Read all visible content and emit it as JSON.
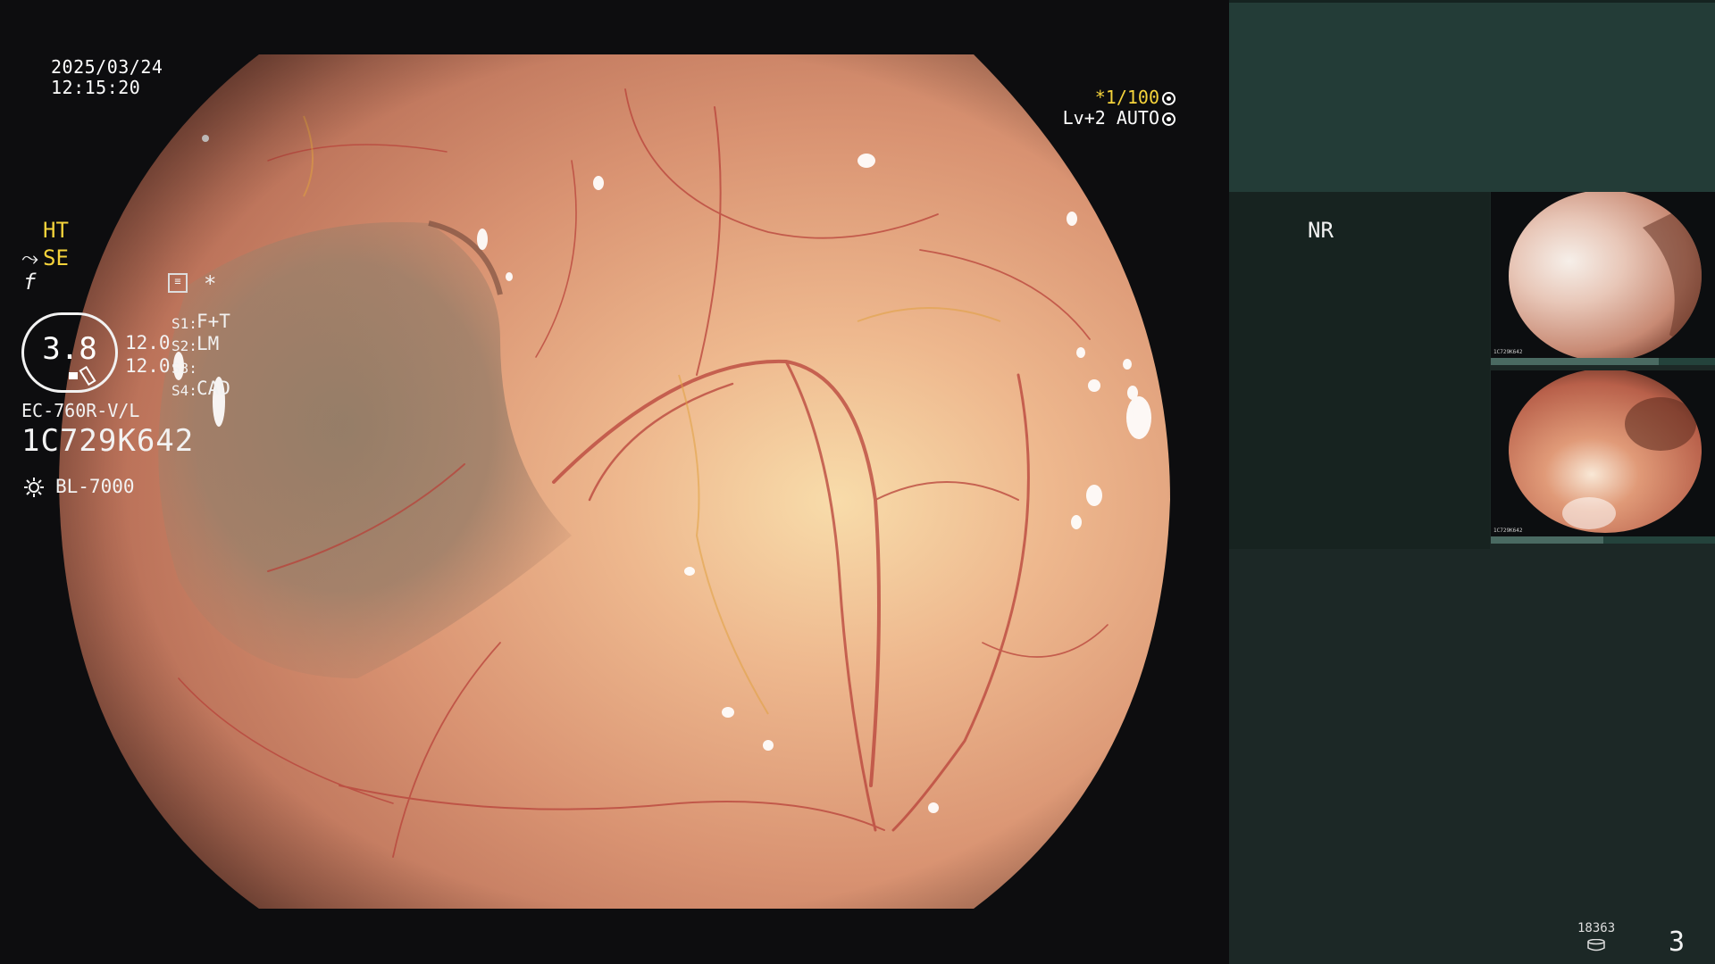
{
  "osd": {
    "date": "2025/03/24",
    "time": "12:15:20",
    "shutter_prefix": "*",
    "shutter": "1/100",
    "iris": "Lv+2 AUTO"
  },
  "panel": {
    "mode_ht": "HT",
    "mode_nr": "NR",
    "mode_se": "SE",
    "se_icon": "⤳",
    "f_icon": "f",
    "star_icon": "*",
    "gauge_value": "3.8",
    "num1": "12.0",
    "num2": "12.0",
    "settings": [
      {
        "key": "S1:",
        "value": "F+T"
      },
      {
        "key": "S2:",
        "value": "LM"
      },
      {
        "key": "S3:",
        "value": ""
      },
      {
        "key": "S4:",
        "value": "CAD"
      }
    ],
    "scope_model": "EC-760R-V/L",
    "scope_serial": "1C729K642",
    "light_source": "BL-7000"
  },
  "thumbnails": [
    {
      "label": "1C729K642",
      "progress": 0.75
    },
    {
      "label": "1C729K642",
      "progress": 0.5
    }
  ],
  "footer": {
    "count": "18363",
    "page": "3"
  },
  "colors": {
    "accent_yellow": "#f5d33b",
    "panel_bg": "#1c2826",
    "panel_top": "#233c37"
  }
}
